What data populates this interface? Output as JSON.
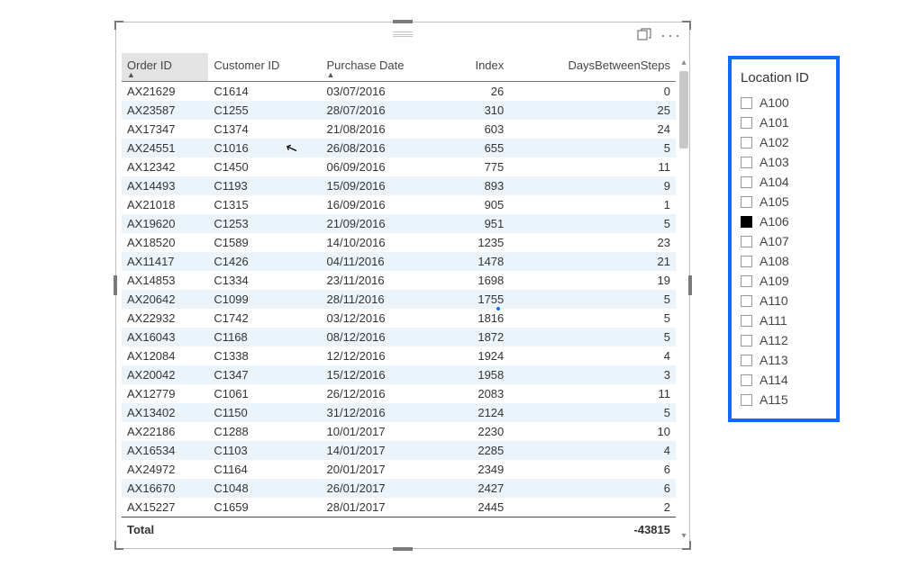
{
  "table": {
    "headers": {
      "order_id": "Order ID",
      "customer_id": "Customer ID",
      "purchase_date": "Purchase Date",
      "index": "Index",
      "days_between": "DaysBetweenSteps"
    },
    "rows": [
      {
        "order": "AX21629",
        "cust": "C1614",
        "date": "03/07/2016",
        "idx": "26",
        "days": "0"
      },
      {
        "order": "AX23587",
        "cust": "C1255",
        "date": "28/07/2016",
        "idx": "310",
        "days": "25"
      },
      {
        "order": "AX17347",
        "cust": "C1374",
        "date": "21/08/2016",
        "idx": "603",
        "days": "24"
      },
      {
        "order": "AX24551",
        "cust": "C1016",
        "date": "26/08/2016",
        "idx": "655",
        "days": "5"
      },
      {
        "order": "AX12342",
        "cust": "C1450",
        "date": "06/09/2016",
        "idx": "775",
        "days": "11"
      },
      {
        "order": "AX14493",
        "cust": "C1193",
        "date": "15/09/2016",
        "idx": "893",
        "days": "9"
      },
      {
        "order": "AX21018",
        "cust": "C1315",
        "date": "16/09/2016",
        "idx": "905",
        "days": "1"
      },
      {
        "order": "AX19620",
        "cust": "C1253",
        "date": "21/09/2016",
        "idx": "951",
        "days": "5"
      },
      {
        "order": "AX18520",
        "cust": "C1589",
        "date": "14/10/2016",
        "idx": "1235",
        "days": "23"
      },
      {
        "order": "AX11417",
        "cust": "C1426",
        "date": "04/11/2016",
        "idx": "1478",
        "days": "21"
      },
      {
        "order": "AX14853",
        "cust": "C1334",
        "date": "23/11/2016",
        "idx": "1698",
        "days": "19"
      },
      {
        "order": "AX20642",
        "cust": "C1099",
        "date": "28/11/2016",
        "idx": "1755",
        "days": "5"
      },
      {
        "order": "AX22932",
        "cust": "C1742",
        "date": "03/12/2016",
        "idx": "1816",
        "days": "5"
      },
      {
        "order": "AX16043",
        "cust": "C1168",
        "date": "08/12/2016",
        "idx": "1872",
        "days": "5"
      },
      {
        "order": "AX12084",
        "cust": "C1338",
        "date": "12/12/2016",
        "idx": "1924",
        "days": "4"
      },
      {
        "order": "AX20042",
        "cust": "C1347",
        "date": "15/12/2016",
        "idx": "1958",
        "days": "3"
      },
      {
        "order": "AX12779",
        "cust": "C1061",
        "date": "26/12/2016",
        "idx": "2083",
        "days": "11"
      },
      {
        "order": "AX13402",
        "cust": "C1150",
        "date": "31/12/2016",
        "idx": "2124",
        "days": "5"
      },
      {
        "order": "AX22186",
        "cust": "C1288",
        "date": "10/01/2017",
        "idx": "2230",
        "days": "10"
      },
      {
        "order": "AX16534",
        "cust": "C1103",
        "date": "14/01/2017",
        "idx": "2285",
        "days": "4"
      },
      {
        "order": "AX24972",
        "cust": "C1164",
        "date": "20/01/2017",
        "idx": "2349",
        "days": "6"
      },
      {
        "order": "AX16670",
        "cust": "C1048",
        "date": "26/01/2017",
        "idx": "2427",
        "days": "6"
      },
      {
        "order": "AX15227",
        "cust": "C1659",
        "date": "28/01/2017",
        "idx": "2445",
        "days": "2"
      }
    ],
    "footer": {
      "label": "Total",
      "value": "-43815"
    }
  },
  "slicer": {
    "title": "Location ID",
    "items": [
      {
        "label": "A100",
        "checked": false
      },
      {
        "label": "A101",
        "checked": false
      },
      {
        "label": "A102",
        "checked": false
      },
      {
        "label": "A103",
        "checked": false
      },
      {
        "label": "A104",
        "checked": false
      },
      {
        "label": "A105",
        "checked": false
      },
      {
        "label": "A106",
        "checked": true
      },
      {
        "label": "A107",
        "checked": false
      },
      {
        "label": "A108",
        "checked": false
      },
      {
        "label": "A109",
        "checked": false
      },
      {
        "label": "A110",
        "checked": false
      },
      {
        "label": "A111",
        "checked": false
      },
      {
        "label": "A112",
        "checked": false
      },
      {
        "label": "A113",
        "checked": false
      },
      {
        "label": "A114",
        "checked": false
      },
      {
        "label": "A115",
        "checked": false
      }
    ]
  }
}
